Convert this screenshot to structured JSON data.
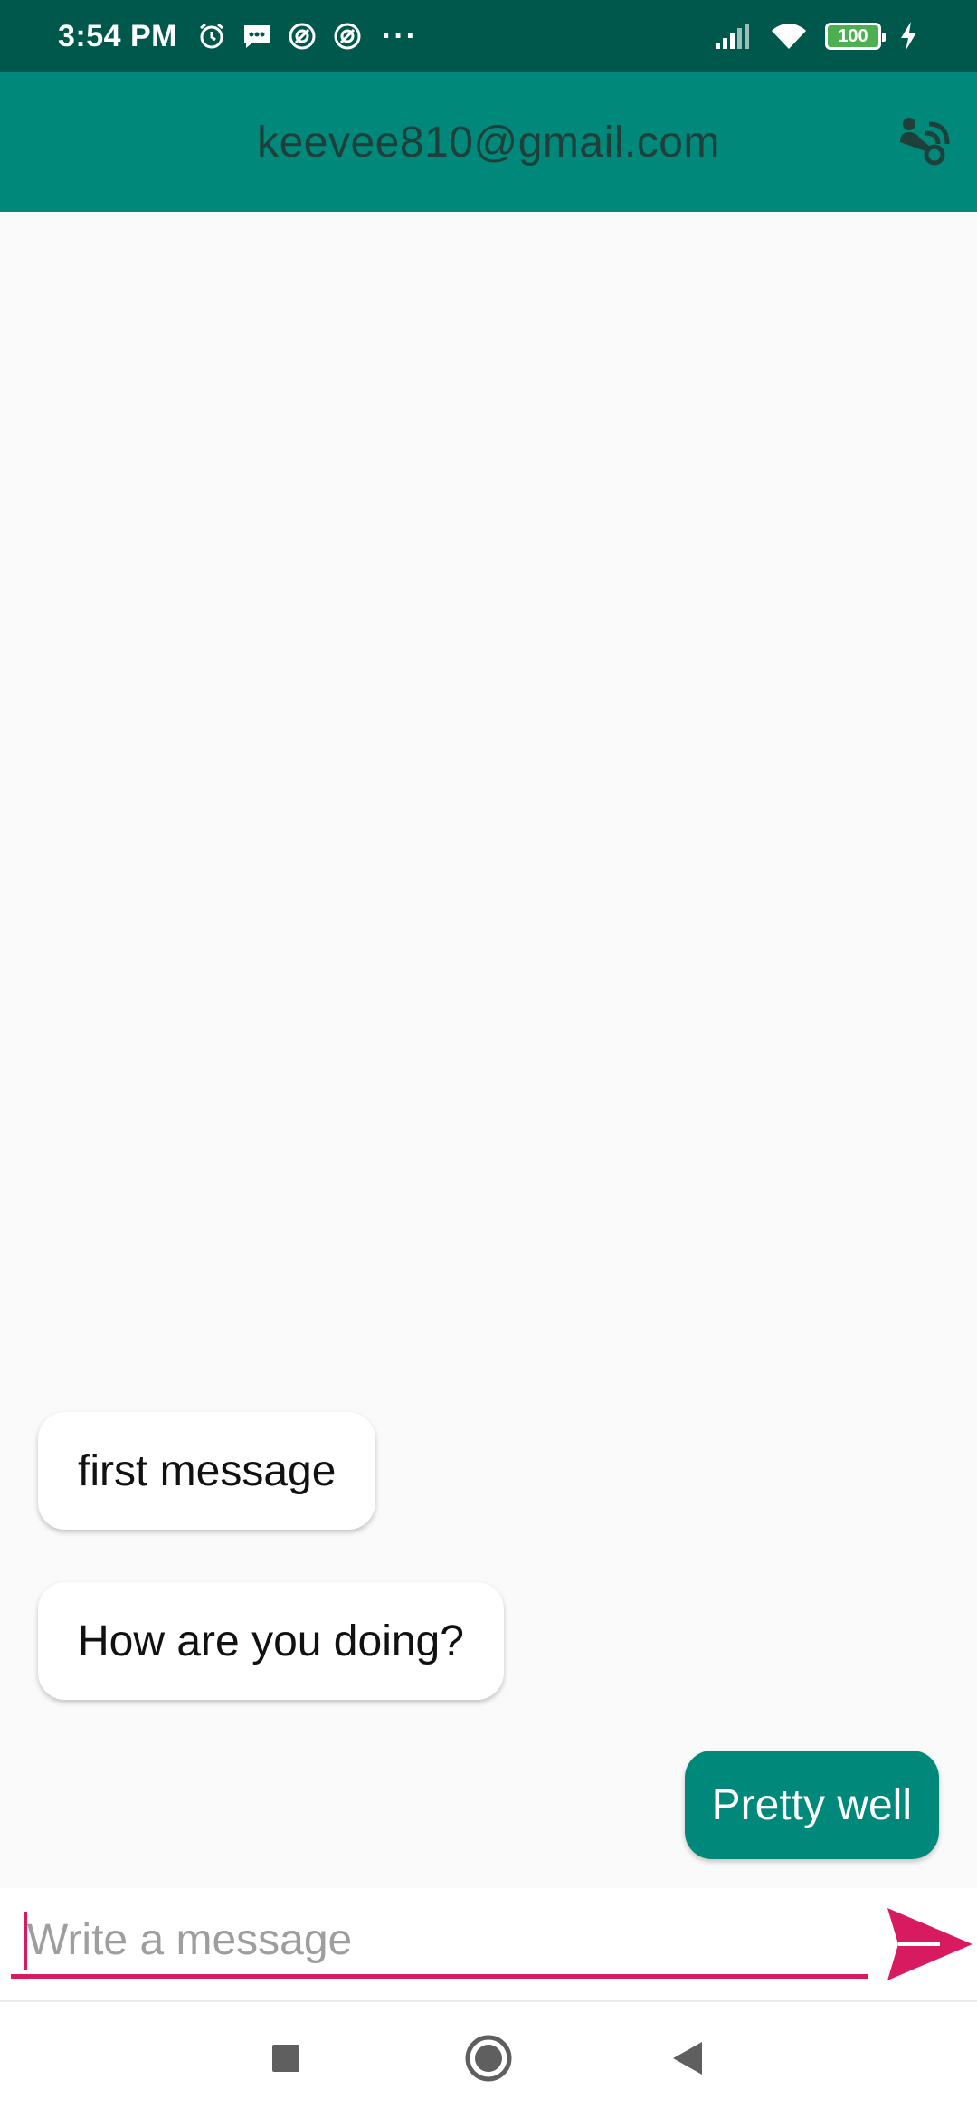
{
  "status_bar": {
    "time": "3:54 PM",
    "left_icons": [
      "alarm-icon",
      "message-icon",
      "sync-icon",
      "sync-icon"
    ],
    "more": "···",
    "right_icons": [
      "signal-icon",
      "wifi-icon",
      "battery-icon",
      "charging-icon"
    ],
    "battery_level": "100"
  },
  "app_bar": {
    "title": "keevee810@gmail.com",
    "action_icon": "video-call-icon"
  },
  "messages": [
    {
      "text": "first message",
      "direction": "incoming"
    },
    {
      "text": "How are you doing?",
      "direction": "incoming"
    },
    {
      "text": "Pretty well",
      "direction": "outgoing"
    }
  ],
  "composer": {
    "value": "",
    "placeholder": "Write a message",
    "send_icon": "send-icon"
  },
  "nav_bar": {
    "items": [
      "recents-icon",
      "home-icon",
      "back-icon"
    ]
  },
  "colors": {
    "status_bar": "#00574b",
    "primary": "#00897b",
    "accent": "#d81b60",
    "background": "#fafafa"
  }
}
